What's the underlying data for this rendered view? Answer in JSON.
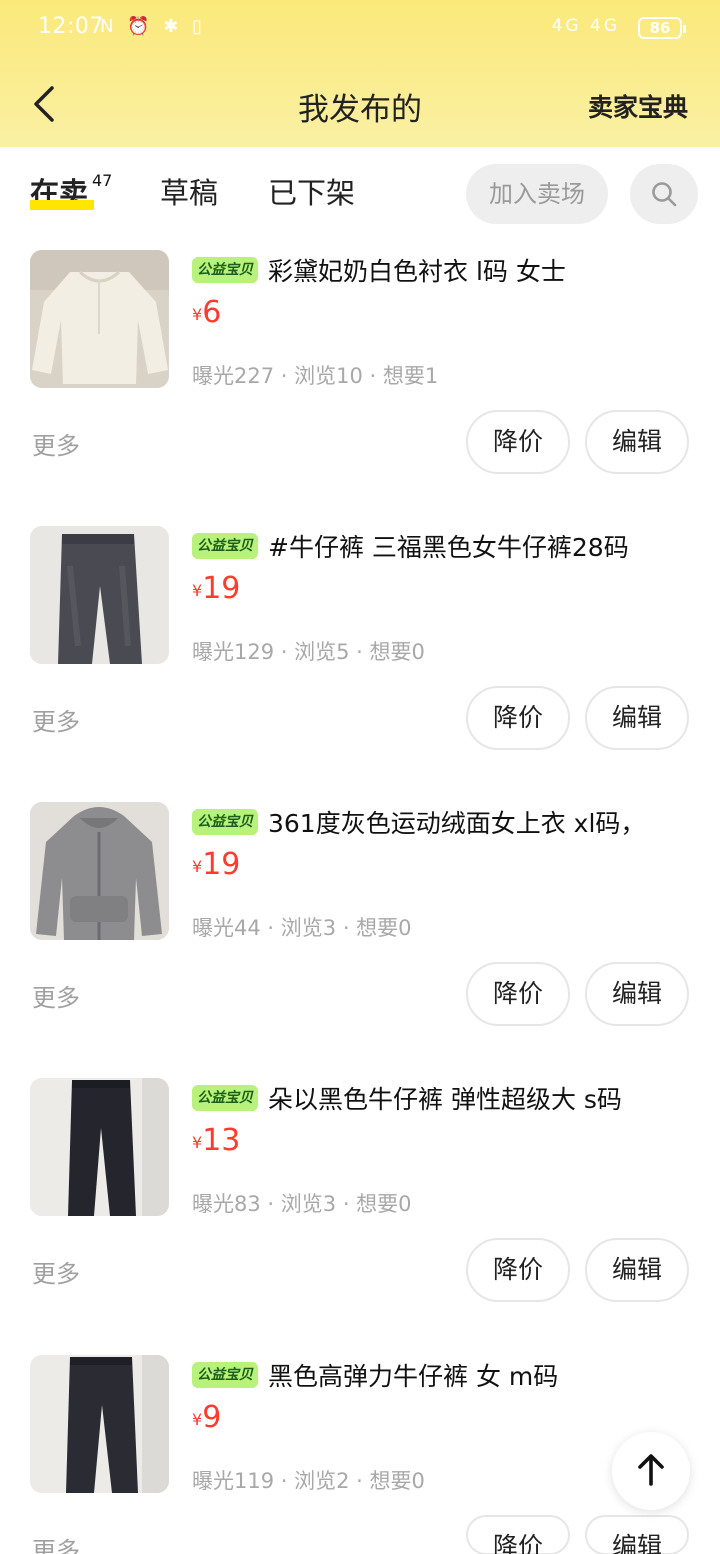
{
  "status_bar": {
    "time": "12:07",
    "left_icons": "N ⏰ ✱ ▯",
    "right_icons": "4G 4G",
    "battery": "86"
  },
  "header": {
    "title": "我发布的",
    "right_link": "卖家宝典"
  },
  "tabs": [
    {
      "label": "在卖",
      "count": "47",
      "active": true
    },
    {
      "label": "草稿",
      "active": false
    },
    {
      "label": "已下架",
      "active": false
    }
  ],
  "join_market_label": "加入卖场",
  "items": [
    {
      "badge": "公益宝贝",
      "title": "彩黛妃奶白色衬衣 l码 女士",
      "currency": "¥",
      "price": "6",
      "exposure": "曝光227",
      "views": "浏览10",
      "wants": "想要1",
      "more": "更多",
      "reduce_label": "降价",
      "edit_label": "编辑",
      "thumb": "white-blouse"
    },
    {
      "badge": "公益宝贝",
      "title": "#牛仔裤 三福黑色女牛仔裤28码",
      "currency": "¥",
      "price": "19",
      "exposure": "曝光129",
      "views": "浏览5",
      "wants": "想要0",
      "more": "更多",
      "reduce_label": "降价",
      "edit_label": "编辑",
      "thumb": "grey-jeans"
    },
    {
      "badge": "公益宝贝",
      "title": "361度灰色运动绒面女上衣 xl码，",
      "currency": "¥",
      "price": "19",
      "exposure": "曝光44",
      "views": "浏览3",
      "wants": "想要0",
      "more": "更多",
      "reduce_label": "降价",
      "edit_label": "编辑",
      "thumb": "grey-hoodie"
    },
    {
      "badge": "公益宝贝",
      "title": "朵以黑色牛仔裤 弹性超级大 s码",
      "currency": "¥",
      "price": "13",
      "exposure": "曝光83",
      "views": "浏览3",
      "wants": "想要0",
      "more": "更多",
      "reduce_label": "降价",
      "edit_label": "编辑",
      "thumb": "black-jeans"
    },
    {
      "badge": "公益宝贝",
      "title": "黑色高弹力牛仔裤 女 m码",
      "currency": "¥",
      "price": "9",
      "exposure": "曝光119",
      "views": "浏览2",
      "wants": "想要0",
      "more": "更多",
      "reduce_label": "降价",
      "edit_label": "编辑",
      "thumb": "black-jeans"
    }
  ],
  "colors": {
    "header_yellow": "#fbe97a",
    "price_red": "#ff3b30",
    "badge_green": "#b8f27a",
    "tab_underline": "#ffe600"
  }
}
